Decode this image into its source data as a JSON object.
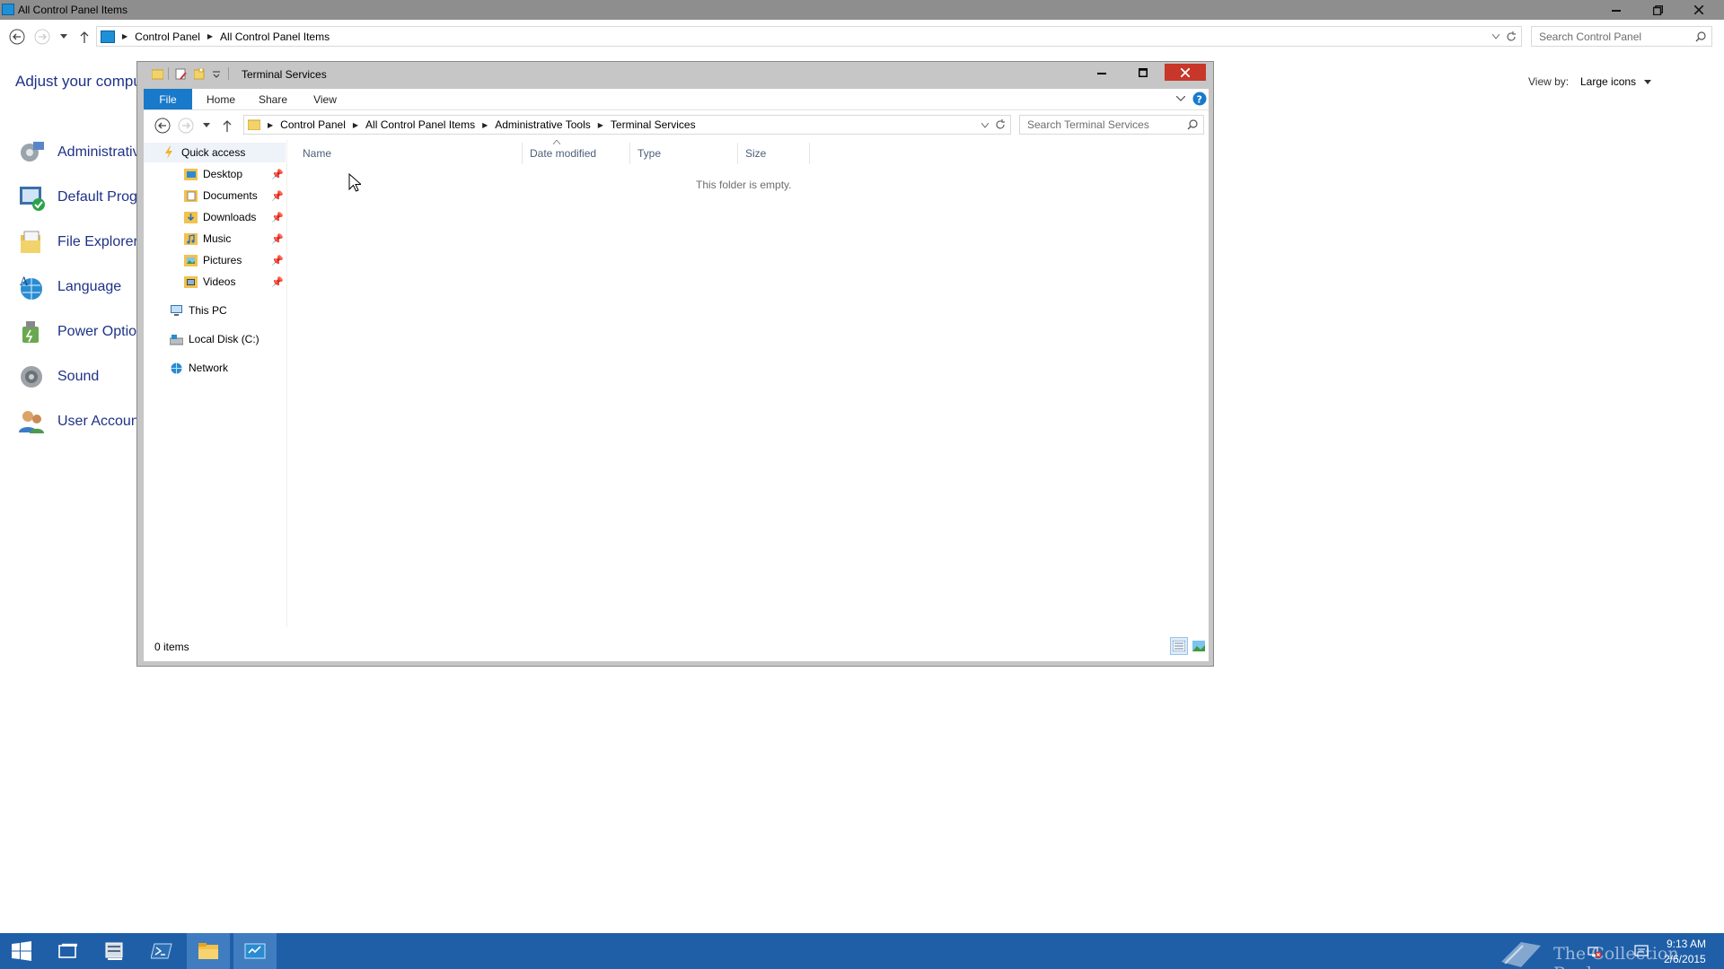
{
  "control_panel": {
    "window_title": "All Control Panel Items",
    "breadcrumb": [
      "Control Panel",
      "All Control Panel Items"
    ],
    "search_placeholder": "Search Control Panel",
    "heading": "Adjust your comput",
    "view_by_label": "View by:",
    "view_by_value": "Large icons",
    "items": [
      {
        "label": "Administrativ",
        "icon": "administrative-tools-icon"
      },
      {
        "label": "Default Progr",
        "icon": "default-programs-icon"
      },
      {
        "label": "File Explorer",
        "icon": "file-explorer-options-icon"
      },
      {
        "label": "Language",
        "icon": "language-icon"
      },
      {
        "label": "Power Option",
        "icon": "power-options-icon"
      },
      {
        "label": "Sound",
        "icon": "sound-icon"
      },
      {
        "label": "User Account",
        "icon": "user-accounts-icon"
      }
    ]
  },
  "explorer": {
    "window_title": "Terminal Services",
    "ribbon_tabs": [
      "File",
      "Home",
      "Share",
      "View"
    ],
    "breadcrumb": [
      "Control Panel",
      "All Control Panel Items",
      "Administrative Tools",
      "Terminal Services"
    ],
    "search_placeholder": "Search Terminal Services",
    "nav": {
      "quick_access": "Quick access",
      "pinned": [
        "Desktop",
        "Documents",
        "Downloads",
        "Music",
        "Pictures",
        "Videos"
      ],
      "this_pc": "This PC",
      "local_disk": "Local Disk (C:)",
      "network": "Network"
    },
    "columns": [
      "Name",
      "Date modified",
      "Type",
      "Size"
    ],
    "empty_message": "This folder is empty.",
    "status_count": "0 items"
  },
  "taskbar": {
    "watermark": "The Collection Book",
    "time": "9:13 AM",
    "date": "2/6/2015"
  },
  "colors": {
    "taskbar": "#1f5fa8",
    "ribbon_file_tab": "#1979ca",
    "link_text": "#1e3287",
    "window_frame": "#c6c6c6"
  }
}
